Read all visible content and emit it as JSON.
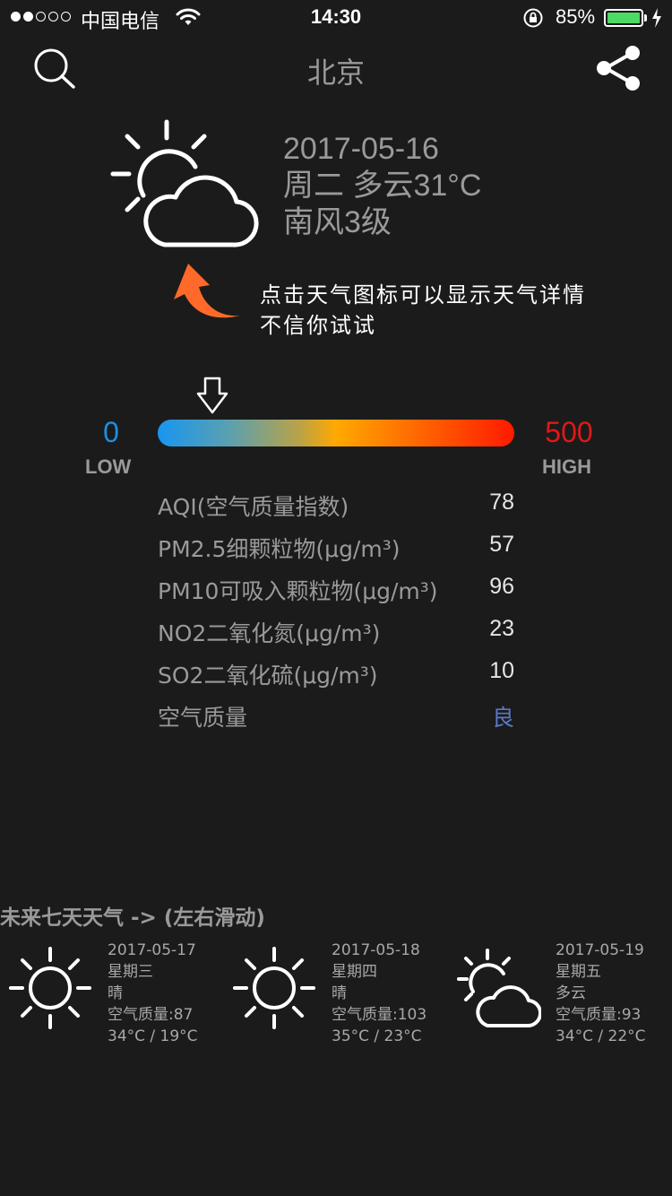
{
  "status_bar": {
    "carrier": "中国电信",
    "time": "14:30",
    "battery": "85%",
    "signal_strength": 2,
    "battery_level_fraction": 0.85,
    "battery_color": "#4cd964"
  },
  "header": {
    "city": "北京",
    "left_icon": "search-icon",
    "right_icon": "share-icon"
  },
  "current": {
    "date": "2017-05-16",
    "day_and_weather": "周二 多云31°C",
    "wind": "南风3级",
    "icon": "partly-cloudy-icon"
  },
  "hint": {
    "line1": "点击天气图标可以显示天气详情",
    "line2": "不信你试试",
    "arrow_color": "#ff6a2a"
  },
  "aqi_scale": {
    "min_value": "0",
    "min_label": "LOW",
    "max_value": "500",
    "max_label": "HIGH",
    "current_aqi": 78,
    "low_color": "#1b8fe6",
    "high_color": "#e01818"
  },
  "aqi_details": [
    {
      "label": "AQI(空气质量指数)",
      "value": "78"
    },
    {
      "label": "PM2.5细颗粒物(μg/m³)",
      "value": "57"
    },
    {
      "label": "PM10可吸入颗粒物(μg/m³)",
      "value": "96"
    },
    {
      "label": "NO2二氧化氮(μg/m³)",
      "value": "23"
    },
    {
      "label": "SO2二氧化硫(μg/m³)",
      "value": "10"
    },
    {
      "label": "空气质量",
      "value": "良"
    }
  ],
  "forecast": {
    "title": "未来七天天气 -> (左右滑动)",
    "days": [
      {
        "date": "2017-05-17",
        "weekday": "星期三",
        "weather": "晴",
        "air_quality": "空气质量:87",
        "temps": "34°C / 19°C",
        "icon": "sun-icon"
      },
      {
        "date": "2017-05-18",
        "weekday": "星期四",
        "weather": "晴",
        "air_quality": "空气质量:103",
        "temps": "35°C / 23°C",
        "icon": "sun-icon"
      },
      {
        "date": "2017-05-19",
        "weekday": "星期五",
        "weather": "多云",
        "air_quality": "空气质量:93",
        "temps": "34°C / 22°C",
        "icon": "partly-cloudy-icon"
      }
    ]
  }
}
